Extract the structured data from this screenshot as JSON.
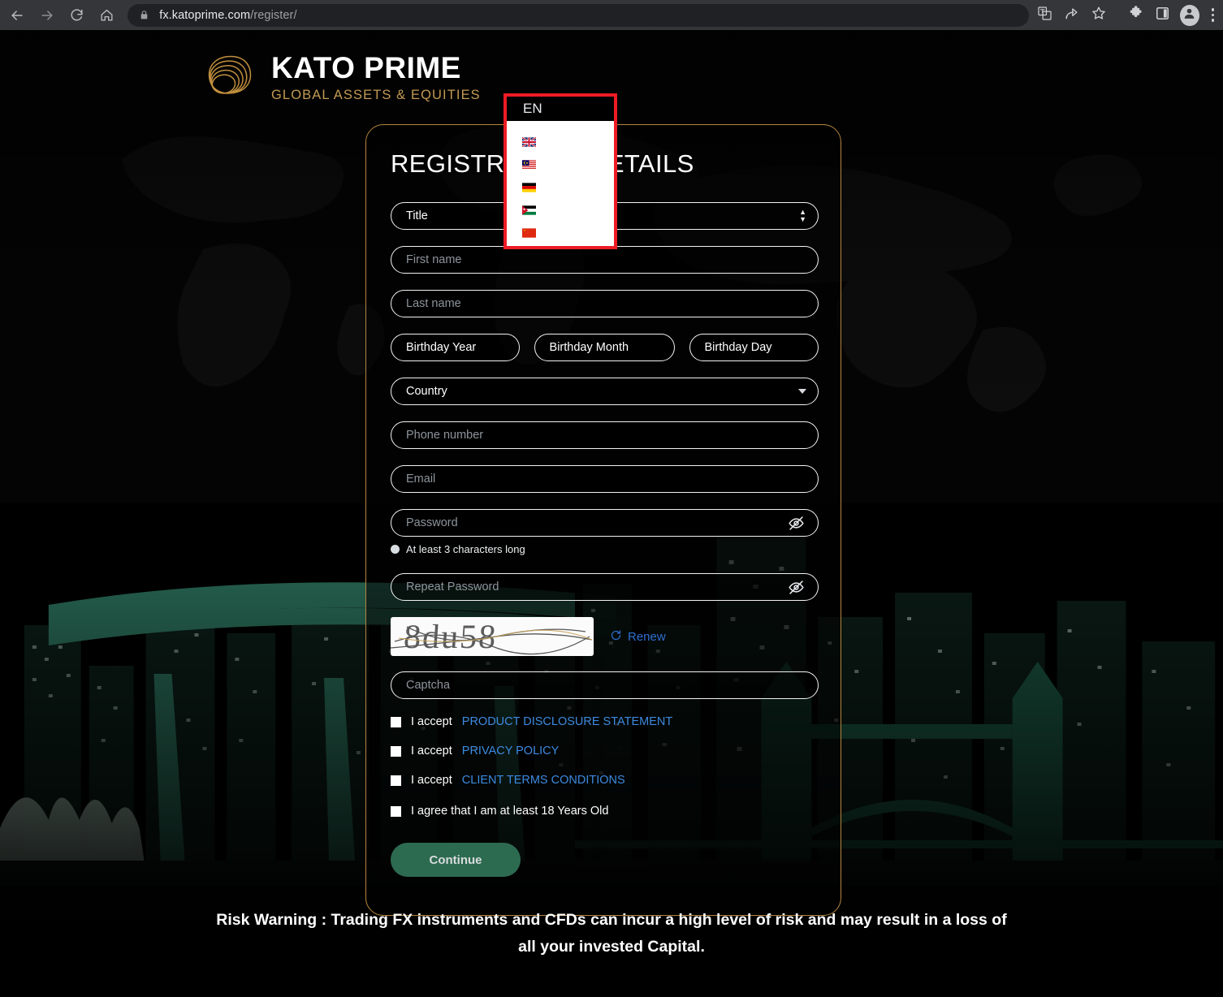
{
  "browser": {
    "url_host": "fx.katoprime.com",
    "url_path": "/register/",
    "back_icon": "back-arrow-icon",
    "forward_icon": "forward-arrow-icon",
    "reload_icon": "reload-icon",
    "home_icon": "home-icon",
    "lock_icon": "lock-icon",
    "translate_icon": "translate-icon",
    "share_icon": "share-icon",
    "bookmark_icon": "star-icon",
    "extensions_icon": "puzzle-icon",
    "sidepanel_icon": "side-panel-icon",
    "profile_icon": "avatar-icon",
    "menu_icon": "three-dot-menu-icon"
  },
  "brand": {
    "title": "KATO PRIME",
    "subtitle": "GLOBAL ASSETS & EQUITIES",
    "gold": "#c29a52"
  },
  "language": {
    "current": "EN",
    "options": [
      {
        "name": "English",
        "flag": "uk-flag-icon"
      },
      {
        "name": "Malay",
        "flag": "malaysia-flag-icon"
      },
      {
        "name": "German",
        "flag": "germany-flag-icon"
      },
      {
        "name": "Arabic",
        "flag": "jordan-flag-icon"
      },
      {
        "name": "Chinese",
        "flag": "china-flag-icon"
      }
    ],
    "highlight_color": "#ee1b24"
  },
  "registration": {
    "heading": "REGISTRATION DETAILS",
    "title_field": {
      "value": "Title",
      "type": "select"
    },
    "first_name": {
      "placeholder": "First name",
      "value": ""
    },
    "last_name": {
      "placeholder": "Last name",
      "value": ""
    },
    "birthday_year": {
      "value": "Birthday Year"
    },
    "birthday_month": {
      "value": "Birthday Month"
    },
    "birthday_day": {
      "value": "Birthday Day"
    },
    "country": {
      "value": "Country",
      "type": "select"
    },
    "phone": {
      "placeholder": "Phone number",
      "value": ""
    },
    "email": {
      "placeholder": "Email",
      "value": ""
    },
    "password": {
      "placeholder": "Password",
      "value": ""
    },
    "password_hint": "At least 3 characters long",
    "repeat_password": {
      "placeholder": "Repeat Password",
      "value": ""
    },
    "captcha_text": "8du58",
    "renew_label": "Renew",
    "renew_icon": "refresh-icon",
    "captcha_input": {
      "placeholder": "Captcha",
      "value": ""
    },
    "consents": [
      {
        "prefix": "I accept",
        "link": "PRODUCT DISCLOSURE STATEMENT",
        "checked": false
      },
      {
        "prefix": "I accept",
        "link": "PRIVACY POLICY",
        "checked": false
      },
      {
        "prefix": "I accept",
        "link": "CLIENT TERMS CONDITIONS",
        "checked": false
      }
    ],
    "age_consent": {
      "label": "I agree that I am at least 18 Years Old",
      "checked": false
    },
    "continue_label": "Continue",
    "continue_color": "#2d6b51",
    "card_border_color": "#b5853f"
  },
  "footer": {
    "risk_warning": "Risk Warning : Trading FX instruments and CFDs can incur a high level of risk and may result in a loss of all your invested Capital."
  }
}
